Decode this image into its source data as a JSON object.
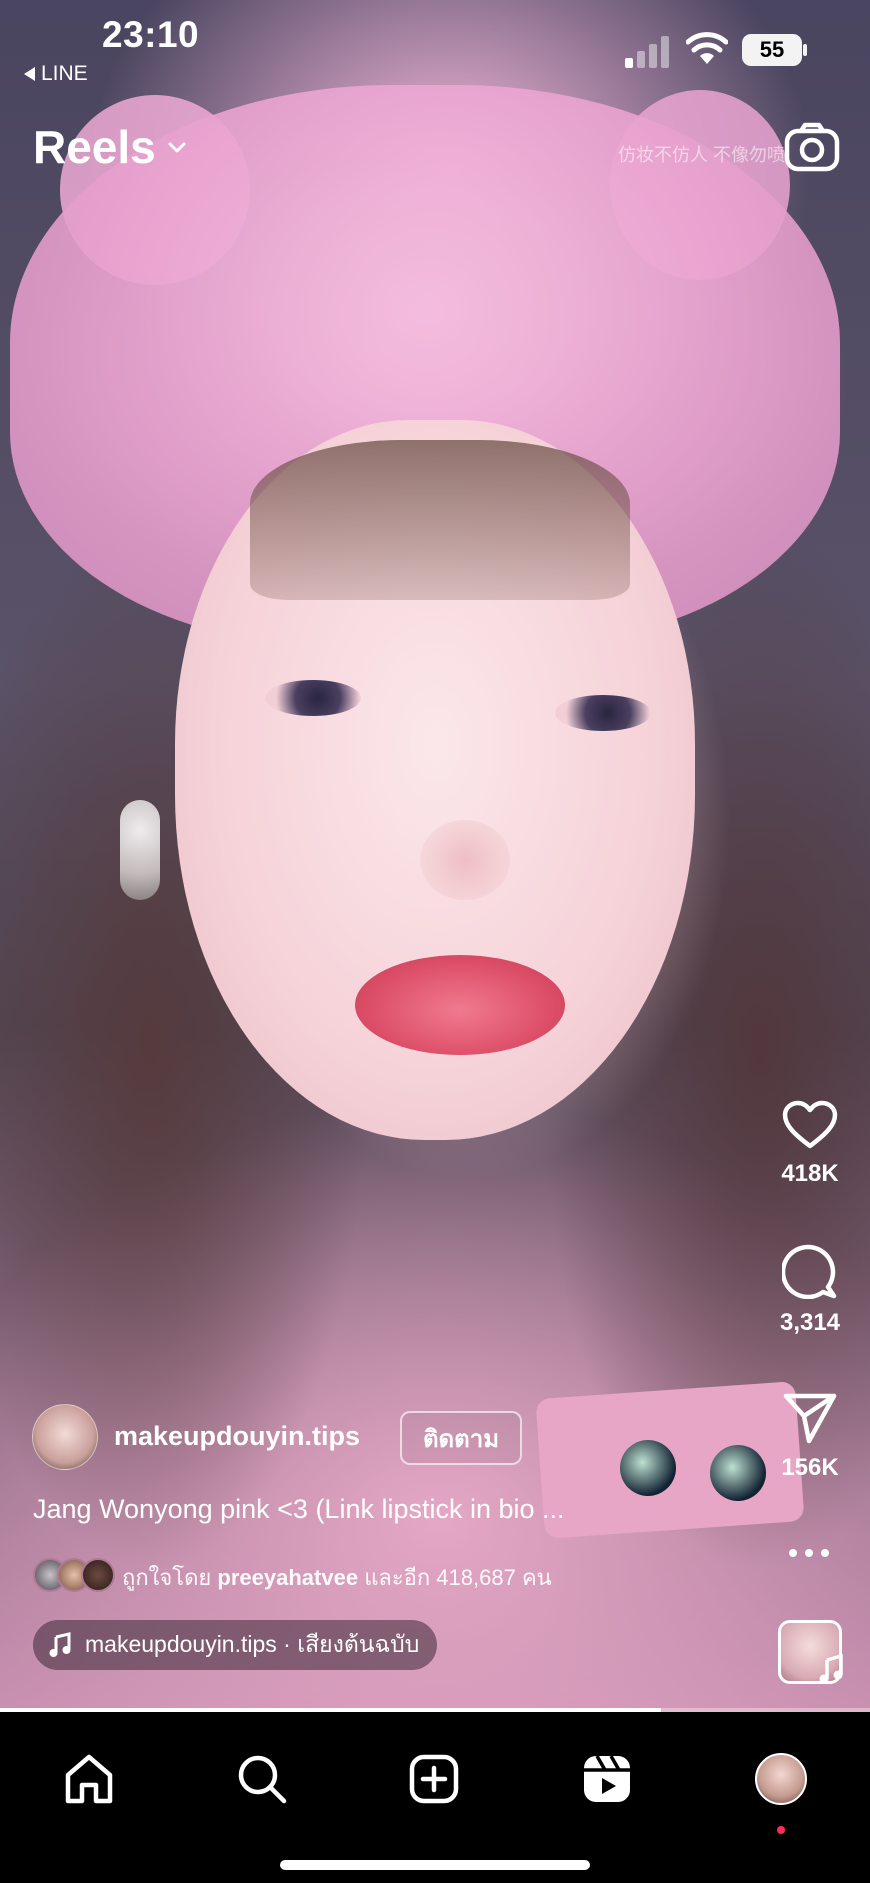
{
  "status_bar": {
    "time": "23:10",
    "back_app": "LINE",
    "battery": "55"
  },
  "header": {
    "title": "Reels",
    "watermark": "仿妆不仿人 不像勿喷"
  },
  "post": {
    "username": "makeupdouyin.tips",
    "follow_label": "ติดตาม",
    "caption": "Jang Wonyong pink <3 (Link lipstick in bio ...",
    "liked_by_prefix": "ถูกใจโดย",
    "liked_by_user": "preeyahatvee",
    "liked_by_suffix": "และอีก 418,687 คน",
    "audio_label": "makeupdouyin.tips · เสียงต้นฉบับ",
    "progress": 0.76
  },
  "actions": {
    "likes": "418K",
    "comments": "3,314",
    "shares": "156K"
  },
  "icons": {
    "like": "heart-icon",
    "comment": "comment-bubble-icon",
    "share": "paper-plane-icon",
    "more": "more-dots-icon",
    "camera": "camera-icon",
    "home": "home-icon",
    "search": "search-icon",
    "create": "plus-square-icon",
    "reels": "reels-icon",
    "profile": "profile-avatar"
  },
  "colors": {
    "notification_dot": "#ff2d55",
    "tabbar_bg": "#000000"
  }
}
